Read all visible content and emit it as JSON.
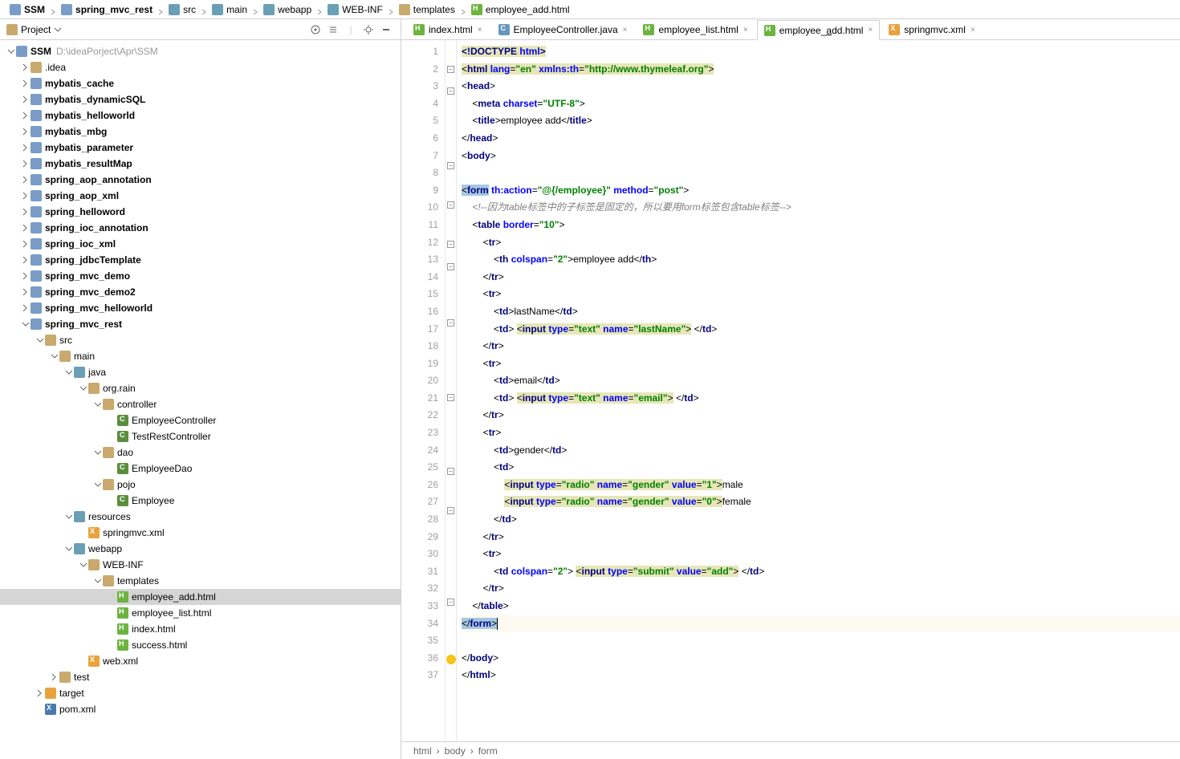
{
  "breadcrumbs": [
    {
      "icon": "mod",
      "label": "SSM",
      "bold": true
    },
    {
      "icon": "mod",
      "label": "spring_mvc_rest",
      "bold": true
    },
    {
      "icon": "folder-blue",
      "label": "src"
    },
    {
      "icon": "folder-blue",
      "label": "main"
    },
    {
      "icon": "folder-blue",
      "label": "webapp"
    },
    {
      "icon": "folder-blue",
      "label": "WEB-INF"
    },
    {
      "icon": "folder",
      "label": "templates"
    },
    {
      "icon": "html",
      "label": "employee_add.html"
    }
  ],
  "project_label": "Project",
  "tree": [
    {
      "d": 0,
      "a": "d",
      "i": "mod",
      "l": "SSM",
      "hint": "D:\\ideaPorject\\Apr\\SSM",
      "bold": true
    },
    {
      "d": 1,
      "a": "r",
      "i": "folder-dot",
      "l": ".idea"
    },
    {
      "d": 1,
      "a": "r",
      "i": "mod",
      "l": "mybatis_cache",
      "bold": true
    },
    {
      "d": 1,
      "a": "r",
      "i": "mod",
      "l": "mybatis_dynamicSQL",
      "bold": true
    },
    {
      "d": 1,
      "a": "r",
      "i": "mod",
      "l": "mybatis_helloworld",
      "bold": true
    },
    {
      "d": 1,
      "a": "r",
      "i": "mod",
      "l": "mybatis_mbg",
      "bold": true
    },
    {
      "d": 1,
      "a": "r",
      "i": "mod",
      "l": "mybatis_parameter",
      "bold": true
    },
    {
      "d": 1,
      "a": "r",
      "i": "mod",
      "l": "mybatis_resultMap",
      "bold": true
    },
    {
      "d": 1,
      "a": "r",
      "i": "mod",
      "l": "spring_aop_annotation",
      "bold": true
    },
    {
      "d": 1,
      "a": "r",
      "i": "mod",
      "l": "spring_aop_xml",
      "bold": true
    },
    {
      "d": 1,
      "a": "r",
      "i": "mod",
      "l": "spring_helloword",
      "bold": true
    },
    {
      "d": 1,
      "a": "r",
      "i": "mod",
      "l": "spring_ioc_annotation",
      "bold": true
    },
    {
      "d": 1,
      "a": "r",
      "i": "mod",
      "l": "spring_ioc_xml",
      "bold": true
    },
    {
      "d": 1,
      "a": "r",
      "i": "mod",
      "l": "spring_jdbcTemplate",
      "bold": true
    },
    {
      "d": 1,
      "a": "r",
      "i": "mod",
      "l": "spring_mvc_demo",
      "bold": true
    },
    {
      "d": 1,
      "a": "r",
      "i": "mod",
      "l": "spring_mvc_demo2",
      "bold": true
    },
    {
      "d": 1,
      "a": "r",
      "i": "mod",
      "l": "spring_mvc_helloworld",
      "bold": true
    },
    {
      "d": 1,
      "a": "d",
      "i": "mod",
      "l": "spring_mvc_rest",
      "bold": true
    },
    {
      "d": 2,
      "a": "d",
      "i": "folder",
      "l": "src"
    },
    {
      "d": 3,
      "a": "d",
      "i": "folder",
      "l": "main"
    },
    {
      "d": 4,
      "a": "d",
      "i": "folder-blue",
      "l": "java"
    },
    {
      "d": 5,
      "a": "d",
      "i": "folder",
      "l": "org.rain"
    },
    {
      "d": 6,
      "a": "d",
      "i": "folder",
      "l": "controller"
    },
    {
      "d": 7,
      "a": "",
      "i": "class",
      "l": "EmployeeController"
    },
    {
      "d": 7,
      "a": "",
      "i": "class",
      "l": "TestRestController"
    },
    {
      "d": 6,
      "a": "d",
      "i": "folder",
      "l": "dao"
    },
    {
      "d": 7,
      "a": "",
      "i": "class",
      "l": "EmployeeDao"
    },
    {
      "d": 6,
      "a": "d",
      "i": "folder",
      "l": "pojo"
    },
    {
      "d": 7,
      "a": "",
      "i": "class",
      "l": "Employee"
    },
    {
      "d": 4,
      "a": "d",
      "i": "folder-blue",
      "l": "resources"
    },
    {
      "d": 5,
      "a": "",
      "i": "xml",
      "l": "springmvc.xml"
    },
    {
      "d": 4,
      "a": "d",
      "i": "folder-blue",
      "l": "webapp"
    },
    {
      "d": 5,
      "a": "d",
      "i": "folder",
      "l": "WEB-INF"
    },
    {
      "d": 6,
      "a": "d",
      "i": "folder",
      "l": "templates"
    },
    {
      "d": 7,
      "a": "",
      "i": "html",
      "l": "employee_add.html",
      "sel": true
    },
    {
      "d": 7,
      "a": "",
      "i": "html",
      "l": "employee_list.html"
    },
    {
      "d": 7,
      "a": "",
      "i": "html",
      "l": "index.html"
    },
    {
      "d": 7,
      "a": "",
      "i": "html",
      "l": "success.html"
    },
    {
      "d": 5,
      "a": "",
      "i": "xml",
      "l": "web.xml"
    },
    {
      "d": 3,
      "a": "r",
      "i": "folder",
      "l": "test"
    },
    {
      "d": 2,
      "a": "r",
      "i": "folder",
      "l": "target",
      "orange": true
    },
    {
      "d": 2,
      "a": "",
      "i": "xml",
      "l": "pom.xml",
      "m": true
    }
  ],
  "tabs": [
    {
      "icon": "html",
      "label": "index.html",
      "active": false
    },
    {
      "icon": "java",
      "label": "EmployeeController.java",
      "active": false
    },
    {
      "icon": "html",
      "label": "employee_list.html",
      "active": false
    },
    {
      "icon": "html",
      "label": "employee_add.html",
      "active": true,
      "underline": "a"
    },
    {
      "icon": "xml",
      "label": "springmvc.xml",
      "active": false
    }
  ],
  "code_lines": 37,
  "statusbar": [
    "html",
    "body",
    "form"
  ]
}
